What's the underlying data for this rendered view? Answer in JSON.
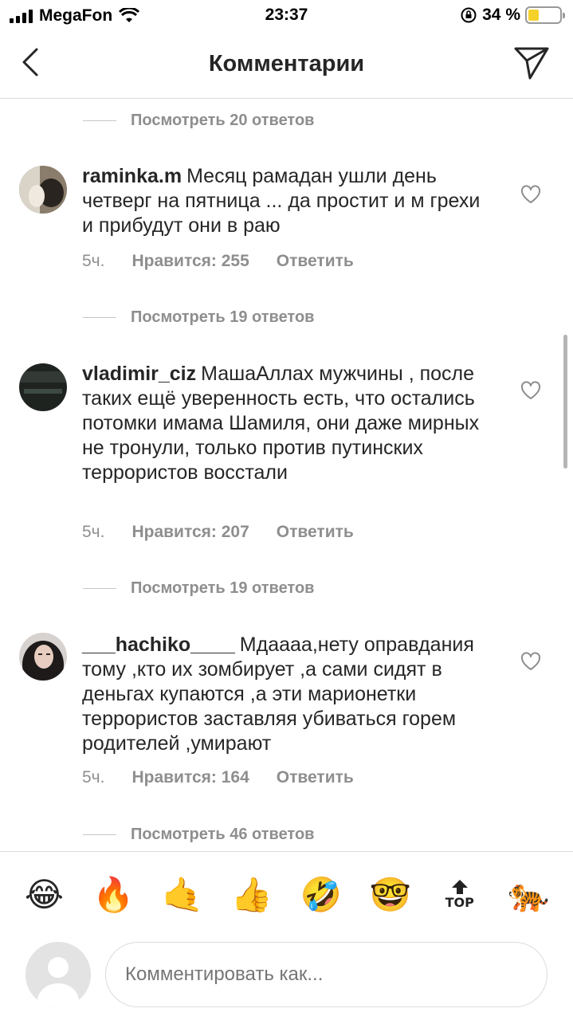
{
  "status_bar": {
    "carrier": "MegaFon",
    "time": "23:37",
    "battery": "34 %",
    "battery_level": 0.34
  },
  "nav": {
    "title": "Комментарии"
  },
  "replies": [
    "Посмотреть 20 ответов",
    "Посмотреть 19 ответов",
    "Посмотреть 19 ответов",
    "Посмотреть 46 ответов"
  ],
  "comments": [
    {
      "user": "raminka.m",
      "text": "Месяц рамадан ушли день четверг на пятница ... да простит и м грехи и прибудут они в раю",
      "time": "5ч.",
      "likes": "Нравится: 255",
      "reply": "Ответить"
    },
    {
      "user": "vladimir_ciz",
      "text": "МашаАллах мужчины , после таких ещё уверенность есть, что остались потомки имама Шамиля, они даже мирных не тронули, только против путинских террористов восстали",
      "time": "5ч.",
      "likes": "Нравится: 207",
      "reply": "Ответить"
    },
    {
      "user": "___hachiko____",
      "text": "Мдаааа,нету оправдания тому ,кто их зомбирует ,а сами сидят в деньгах купаются ,а эти марионетки террористов  заставляя убиваться горем родителей ,умирают",
      "time": "5ч.",
      "likes": "Нравится: 164",
      "reply": "Ответить"
    }
  ],
  "emoji_bar": [
    "😂",
    "🔥",
    "🤙",
    "👍",
    "🤣",
    "🤓",
    "TOP",
    "🐅"
  ],
  "input": {
    "placeholder": "Комментировать как..."
  }
}
